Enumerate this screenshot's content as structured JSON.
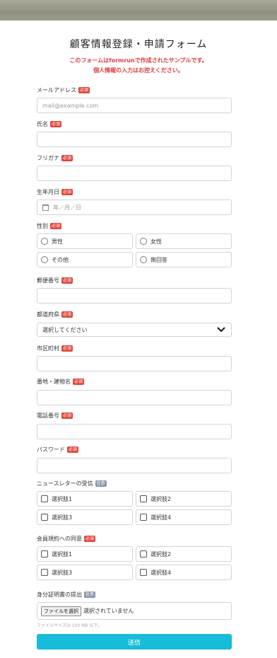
{
  "form": {
    "title": "顧客情報登録・申請フォーム",
    "notice_line1": "このフォームはformrunで作成されたサンプルです。",
    "notice_line2": "個人情報の入力はお控えください。",
    "required_badge": "必須",
    "optional_badge": "任意"
  },
  "fields": {
    "email": {
      "label": "メールアドレス",
      "placeholder": "mail@example.com"
    },
    "name": {
      "label": "氏名"
    },
    "furigana": {
      "label": "フリガナ"
    },
    "birthdate": {
      "label": "生年月日",
      "placeholder": "年／月／日"
    },
    "gender": {
      "label": "性別",
      "options": [
        "男性",
        "女性",
        "その他",
        "無回答"
      ]
    },
    "postal": {
      "label": "郵便番号"
    },
    "prefecture": {
      "label": "都道府県",
      "selected": "選択してください"
    },
    "city": {
      "label": "市区町村"
    },
    "address": {
      "label": "番地・建物名"
    },
    "phone": {
      "label": "電話番号"
    },
    "password": {
      "label": "パスワード"
    },
    "newsletter": {
      "label": "ニュースレターの受信",
      "options": [
        "選択肢1",
        "選択肢2",
        "選択肢3",
        "選択肢4"
      ]
    },
    "terms": {
      "label": "会員規約への同意",
      "options": [
        "選択肢1",
        "選択肢2",
        "選択肢3",
        "選択肢4"
      ]
    },
    "id_doc": {
      "label": "身分証明書の提出",
      "button": "ファイルを選択",
      "status": "選択されていません",
      "note": "ファイルサイズは 100 MB 以下。"
    }
  },
  "submit_label": "送信",
  "colors": {
    "required": "#e0453b",
    "optional": "#8897a6",
    "accent": "#17bcd8",
    "notice": "#e03b3b"
  }
}
